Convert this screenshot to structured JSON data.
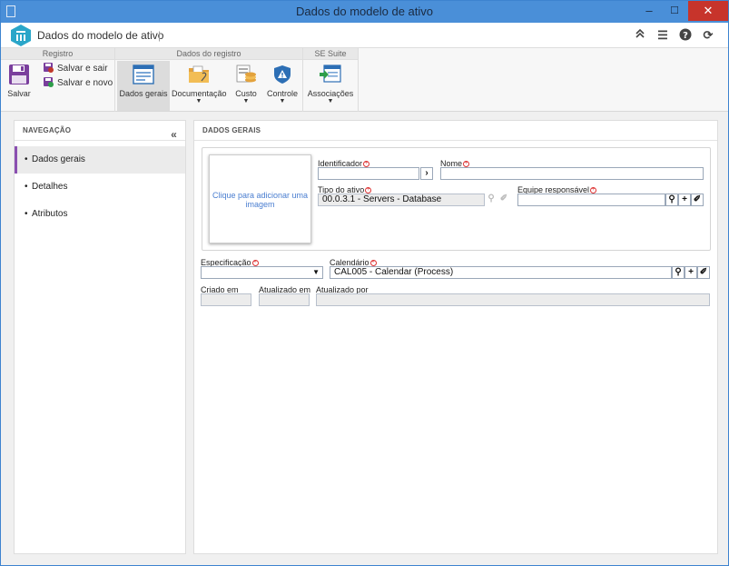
{
  "window": {
    "title": "Dados do modelo de ativo",
    "minimize": "–",
    "maximize": "☐",
    "close": "✕"
  },
  "app": {
    "title": "Dados do modelo de ativo",
    "separator": "|"
  },
  "header_icons": {
    "collapse": "≽",
    "list": "☰",
    "help": "?",
    "refresh": "⟳"
  },
  "ribbon": {
    "groups": [
      {
        "title": "Registro"
      },
      {
        "title": "Dados do registro"
      },
      {
        "title": "SE Suite"
      }
    ],
    "save_label": "Salvar",
    "save_exit_label": "Salvar e sair",
    "save_new_label": "Salvar e novo",
    "general_data_label": "Dados gerais",
    "documentation_label": "Documentação",
    "cost_label": "Custo",
    "control_label": "Controle",
    "associations_label": "Associações",
    "dropdown_arrow": "▼"
  },
  "nav": {
    "title": "NAVEGAÇÃO",
    "collapse_icon": "«",
    "items": [
      {
        "label": "Dados gerais",
        "active": true
      },
      {
        "label": "Detalhes"
      },
      {
        "label": "Atributos"
      }
    ],
    "bullet": "•"
  },
  "main": {
    "title": "DADOS GERAIS",
    "image_placeholder": "Clique para adicionar uma imagem",
    "identifier_label": "Identificador",
    "identifier_value": "",
    "name_label": "Nome",
    "name_value": "",
    "asset_type_label": "Tipo do ativo",
    "asset_type_value": "00.0.3.1 - Servers - Database",
    "responsible_team_label": "Equipe responsável",
    "responsible_team_value": "",
    "specification_label": "Especificação",
    "specification_value": "",
    "calendar_label": "Calendário",
    "calendar_value": "CAL005 - Calendar (Process)",
    "created_on_label": "Criado em",
    "created_on_value": "",
    "updated_on_label": "Atualizado em",
    "updated_on_value": "",
    "updated_by_label": "Atualizado por",
    "updated_by_value": "",
    "required_mark": "+",
    "arrow_btn": "›",
    "search_btn": "⚲",
    "add_btn": "+",
    "clear_btn": "✐",
    "select_arrow": "▼"
  }
}
